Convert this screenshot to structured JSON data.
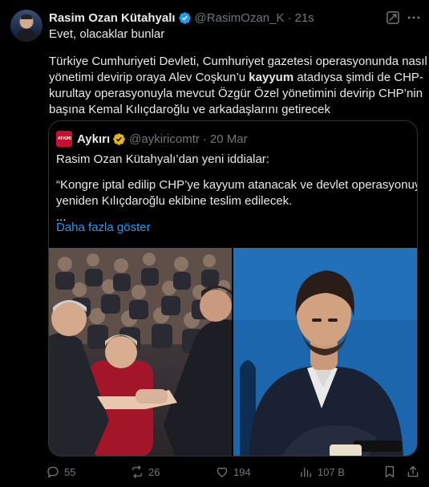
{
  "author": {
    "display_name": "Rasim Ozan Kütahyalı",
    "handle": "@RasimOzan_K",
    "separator": "·",
    "time": "21s"
  },
  "tweet": {
    "line1": "Evet, olacaklar bunlar",
    "p2_line1": "Türkiye Cumhuriyeti Devleti, Cumhuriyet gazetesi operasyonunda nasıl",
    "p2_line2_a": "yönetimi devirip oraya Alev Coşkun’u ",
    "p2_line2_bold": "kayyum",
    "p2_line2_b": " atadıysa şimdi de CHP-",
    "p2_line3": "kurultay operasyonuyla mevcut Özgür Özel yönetimini devirip CHP’nin",
    "p2_line4": "başına Kemal Kılıçdaroğlu ve arkadaşlarını getirecek"
  },
  "quote": {
    "avatar_text": "AYKIRI",
    "display_name": "Aykırı",
    "handle": "@aykiricomtr",
    "separator": "·",
    "date": "20 Mar",
    "line1": "Rasim Ozan Kütahyalı’dan yeni iddialar:",
    "line2": "“Kongre iptal edilip CHP’ye kayyum atanacak ve devlet operasyonuyla",
    "line3": "yeniden Kılıçdaroğlu ekibine teslim edilecek.",
    "line4": "...",
    "show_more": "Daha fazla göster"
  },
  "actions": {
    "replies": "55",
    "reposts": "26",
    "likes": "194",
    "views": "107 B"
  },
  "colors": {
    "background": "#000000",
    "text": "#e7e9ea",
    "muted": "#71767b",
    "link": "#1d9bf0",
    "verified_blue": "#1d9bf0",
    "verified_gold": "#e2b719",
    "border": "#2f3336"
  }
}
